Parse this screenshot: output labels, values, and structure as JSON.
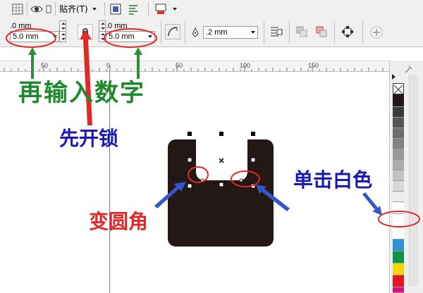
{
  "toolbar1": {
    "snap_label": "贴齐(T)",
    "icons": [
      "eye-icon",
      "view-icon",
      "page-setup-icon",
      "align-icon",
      "color-icon"
    ]
  },
  "toolbar2": {
    "corner_top_left": ".0 mm",
    "corner_bottom_left": "5.0 mm",
    "corner_top_right": ".0 mm",
    "corner_bottom_right": "5.0 mm",
    "outline_width": ".2 mm"
  },
  "ruler": {
    "ticks": [
      "50",
      "0",
      "50",
      "100",
      "150"
    ]
  },
  "annotations": {
    "enter_numbers": "再输入数字",
    "unlock_first": "先开锁",
    "round_corner": "变圆角",
    "click_white": "单击白色"
  },
  "colors": {
    "annotation_green": "#1e8a2e",
    "annotation_blue": "#1a1ab0",
    "annotation_red": "#e02a2a",
    "shape_fill": "#231815"
  },
  "palette": {
    "swatches": [
      "#ffffff",
      "#231815",
      "#3a3a3a",
      "#555555",
      "#6c6c6c",
      "#828282",
      "#989898",
      "#adadad",
      "#c3c3c3",
      "#d8d8d8",
      "#ececec",
      "#ffffff",
      "#ffffff",
      "#2f93d5",
      "#0b9647",
      "#f5d400",
      "#e4161f",
      "#d6127e"
    ]
  }
}
